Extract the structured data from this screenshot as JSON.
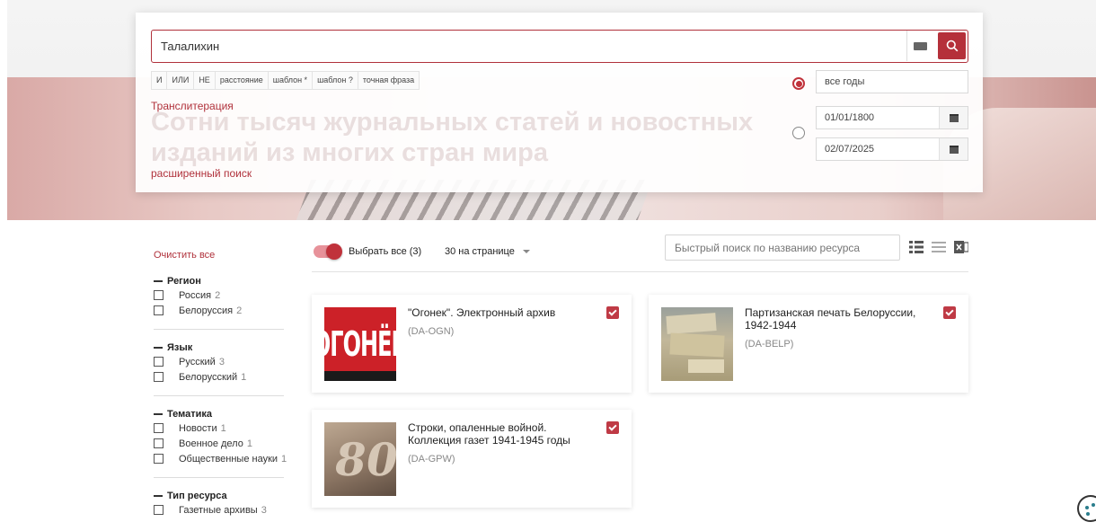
{
  "search": {
    "query": "Талалихин",
    "operators": [
      "И",
      "ИЛИ",
      "НЕ",
      "расстояние",
      "шаблон *",
      "шаблон ?",
      "точная фраза"
    ],
    "transliteration_label": "Транслитерация",
    "advanced_label": "расширенный поиск",
    "all_years_label": "все годы",
    "date_from": "01/01/1800",
    "date_to": "02/07/2025",
    "accent_color": "#b5303a"
  },
  "hero": {
    "line1": "Сотни тысяч журнальных статей и новостных",
    "line2": "изданий из многих стран мира"
  },
  "sidebar": {
    "clear_all": "Очистить все",
    "facets": [
      {
        "title": "Регион",
        "items": [
          {
            "label": "Россия",
            "count": "2"
          },
          {
            "label": "Белоруссия",
            "count": "2"
          }
        ]
      },
      {
        "title": "Язык",
        "items": [
          {
            "label": "Русский",
            "count": "3"
          },
          {
            "label": "Белорусский",
            "count": "1"
          }
        ]
      },
      {
        "title": "Тематика",
        "items": [
          {
            "label": "Новости",
            "count": "1"
          },
          {
            "label": "Военное дело",
            "count": "1"
          },
          {
            "label": "Общественные науки",
            "count": "1"
          }
        ]
      },
      {
        "title": "Тип ресурса",
        "items": [
          {
            "label": "Газетные архивы",
            "count": "3"
          }
        ]
      }
    ]
  },
  "toolbar": {
    "select_all": "Выбрать все (3)",
    "per_page": "30 на странице",
    "quick_search_placeholder": "Быстрый поиск по названию ресурса"
  },
  "results": [
    {
      "title": "\"Огонек\". Электронный архив",
      "code": "(DA-OGN)",
      "thumb_text": "ОГОНЁК",
      "checked": true
    },
    {
      "title": "Партизанская печать Белоруссии, 1942-1944",
      "code": "(DA-BELP)",
      "checked": true
    },
    {
      "title": "Строки, опаленные войной. Коллекция газет 1941-1945 годы",
      "code": "(DA-GPW)",
      "thumb_text": "80",
      "checked": true
    }
  ]
}
